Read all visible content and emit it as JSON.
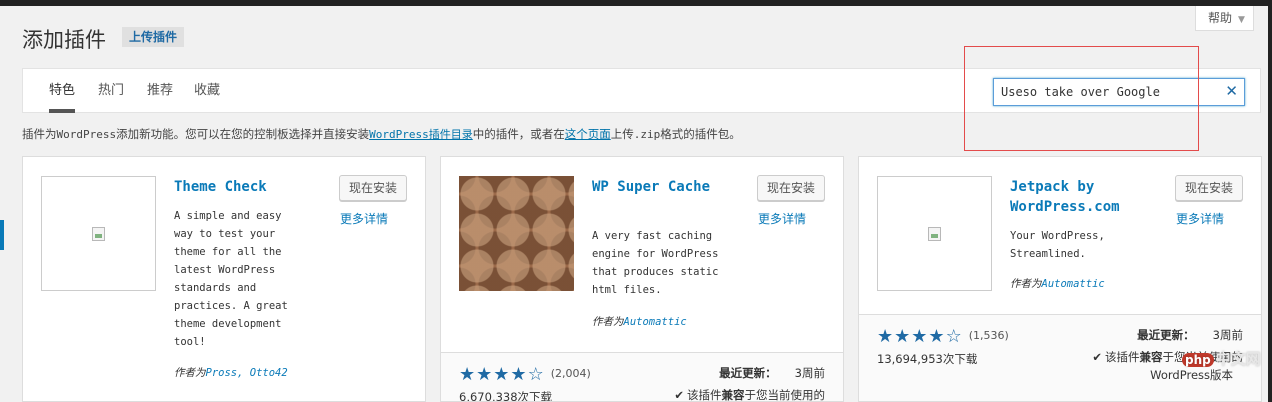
{
  "header": {
    "title": "添加插件",
    "upload_button": "上传插件",
    "help": "帮助"
  },
  "tabs": [
    {
      "label": "特色",
      "active": true
    },
    {
      "label": "热门",
      "active": false
    },
    {
      "label": "推荐",
      "active": false
    },
    {
      "label": "收藏",
      "active": false
    }
  ],
  "search": {
    "value": "Useso take over Google"
  },
  "intro": {
    "part1": "插件为",
    "wp1": "WordPress",
    "part2": "添加新功能。您可以在您的控制板选择并直接安装",
    "link1": "WordPress插件目录",
    "part3": "中的插件，或者在",
    "link2": "这个页面",
    "part4": "上传",
    "zip": ".zip",
    "part5": "格式的插件包。"
  },
  "plugins": [
    {
      "name": "Theme Check",
      "description": "A simple and easy way to test your theme for all the latest WordPress standards and practices. A great theme development tool!",
      "author_prefix": "作者为",
      "author": "Pross, Otto42",
      "install_label": "现在安装",
      "details_label": "更多详情"
    },
    {
      "name": "WP Super Cache",
      "description": "A very fast caching engine for WordPress that produces static html files.",
      "author_prefix": "作者为",
      "author": "Automattic",
      "install_label": "现在安装",
      "details_label": "更多详情",
      "rating_count": "(2,004)",
      "rating": 4,
      "downloads": "6,670,338次下载",
      "updated_label": "最近更新：",
      "updated_value": "3周前",
      "compat_label": "该插件",
      "compat_bold": "兼容",
      "compat_rest": "于您当前使用的"
    },
    {
      "name": "Jetpack by WordPress.com",
      "description": "Your WordPress, Streamlined.",
      "author_prefix": "作者为",
      "author": "Automattic",
      "install_label": "现在安装",
      "details_label": "更多详情",
      "rating_count": "(1,536)",
      "rating": 4,
      "downloads": "13,694,953次下载",
      "updated_label": "最近更新：",
      "updated_value": "3周前",
      "compat_label": "该插件",
      "compat_bold": "兼容",
      "compat_rest": "于您当前使用的",
      "compat_line2": "WordPress版本"
    }
  ],
  "watermark": {
    "badge": "php",
    "text": "中文网"
  }
}
